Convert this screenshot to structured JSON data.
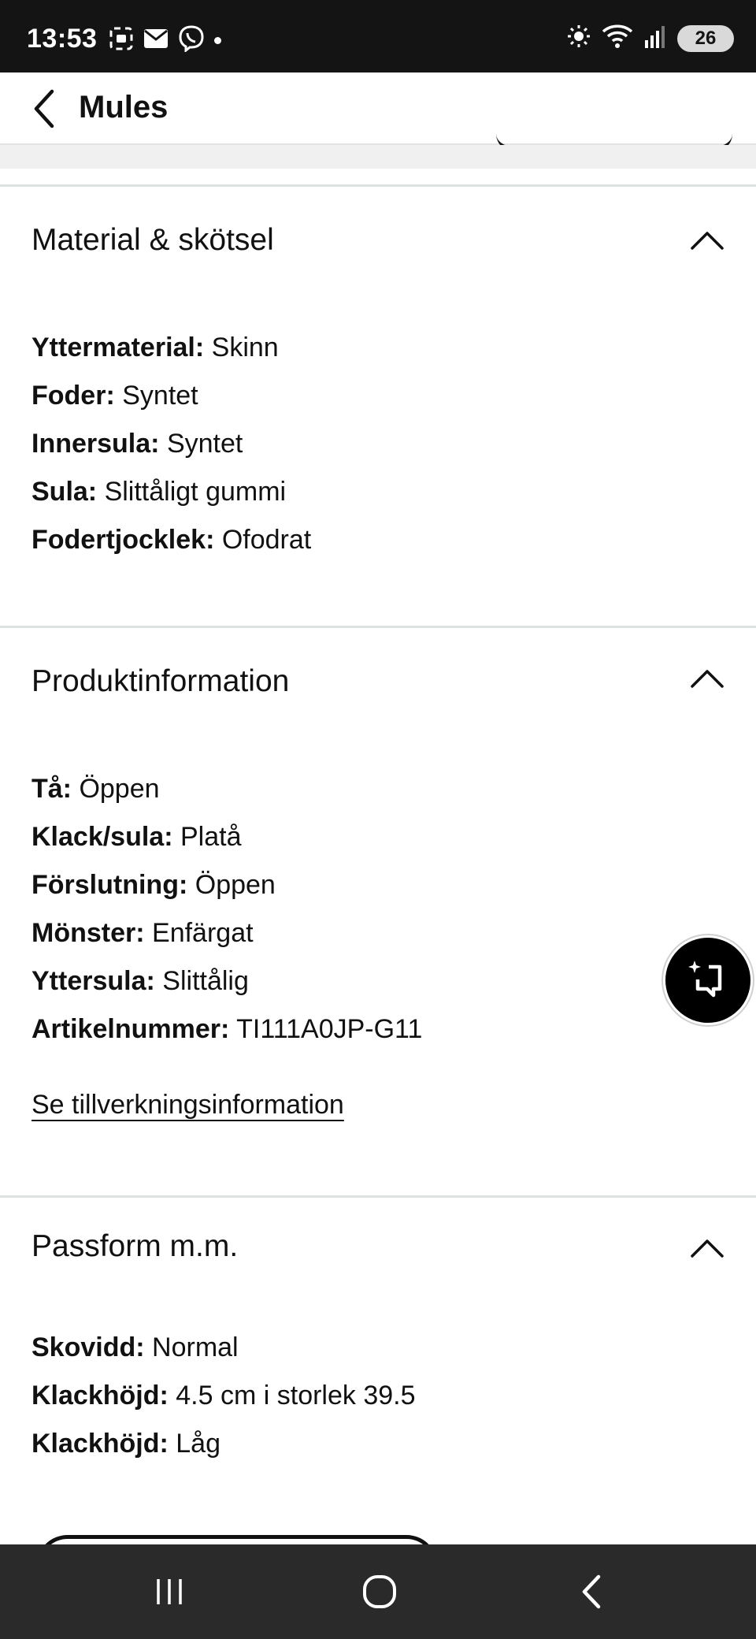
{
  "status_bar": {
    "time": "13:53",
    "battery": "26",
    "left_icons": [
      "screenshot-icon",
      "mail-icon",
      "viber-icon"
    ],
    "right_icons": [
      "brightness-icon",
      "wifi-icon",
      "signal-icon"
    ]
  },
  "header": {
    "title": "Mules"
  },
  "sections": {
    "material": {
      "title": "Material & skötsel",
      "items": [
        {
          "key": "Yttermaterial:",
          "value": "Skinn"
        },
        {
          "key": "Foder:",
          "value": "Syntet"
        },
        {
          "key": "Innersula:",
          "value": "Syntet"
        },
        {
          "key": "Sula:",
          "value": "Slittåligt gummi"
        },
        {
          "key": "Fodertjocklek:",
          "value": "Ofodrat"
        }
      ]
    },
    "product": {
      "title": "Produktinformation",
      "items": [
        {
          "key": "Tå:",
          "value": "Öppen"
        },
        {
          "key": "Klack/sula:",
          "value": "Platå"
        },
        {
          "key": "Förslutning:",
          "value": "Öppen"
        },
        {
          "key": "Mönster:",
          "value": "Enfärgat"
        },
        {
          "key": "Yttersula:",
          "value": "Slittålig"
        },
        {
          "key": "Artikelnummer:",
          "value": "TI111A0JP-G11"
        }
      ],
      "link": "Se tillverkningsinformation"
    },
    "fit": {
      "title": "Passform m.m.",
      "items": [
        {
          "key": "Skovidd:",
          "value": "Normal"
        },
        {
          "key": "Klackhöjd:",
          "value": "4.5 cm i storlek 39.5"
        },
        {
          "key": "Klackhöjd:",
          "value": "Låg"
        }
      ]
    }
  },
  "nav_bar": {
    "icons": [
      "recent-apps-icon",
      "home-icon",
      "back-icon"
    ]
  }
}
